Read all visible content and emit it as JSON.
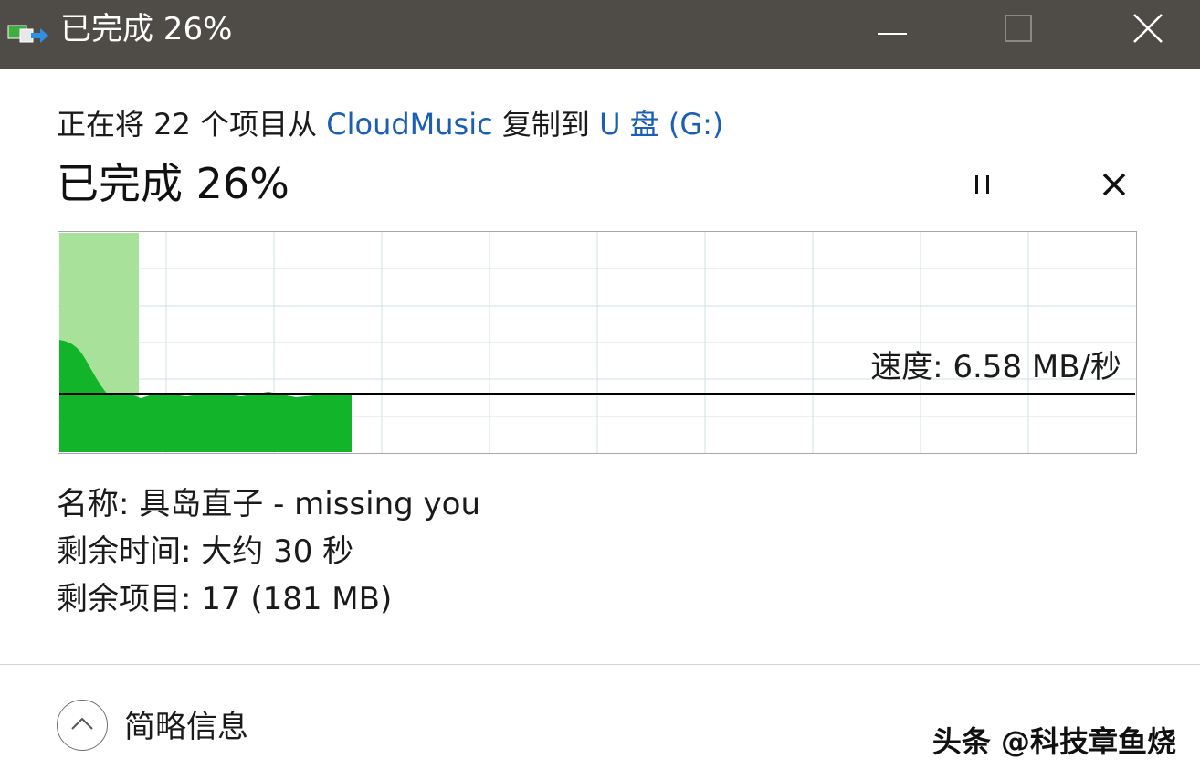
{
  "window": {
    "title": "已完成 26%"
  },
  "summary": {
    "prefix": "正在将 22 个项目从 ",
    "source": "CloudMusic",
    "middle": " 复制到 ",
    "destination": "U 盘 (G:)"
  },
  "progress": {
    "heading": "已完成 26%",
    "percent": 26
  },
  "graph": {
    "speed_label": "速度: 6.58 MB/秒",
    "colors": {
      "progress_fill": "#a8e29a",
      "speed_fill": "#12b42a",
      "grid": "#cfe3e6",
      "speed_line": "#000000"
    }
  },
  "details": {
    "name": "名称: 具岛直子 - missing you",
    "time_remaining": "剩余时间: 大约 30 秒",
    "items_remaining": "剩余项目: 17 (181 MB)"
  },
  "footer": {
    "collapse_label": "简略信息",
    "watermark": "头条 @科技章鱼烧"
  },
  "icons": {
    "app": "file-copy-icon",
    "minimize": "minimize-icon",
    "maximize": "maximize-icon",
    "close": "close-icon",
    "pause": "pause-icon",
    "cancel": "cancel-icon",
    "collapse": "chevron-up-icon"
  }
}
